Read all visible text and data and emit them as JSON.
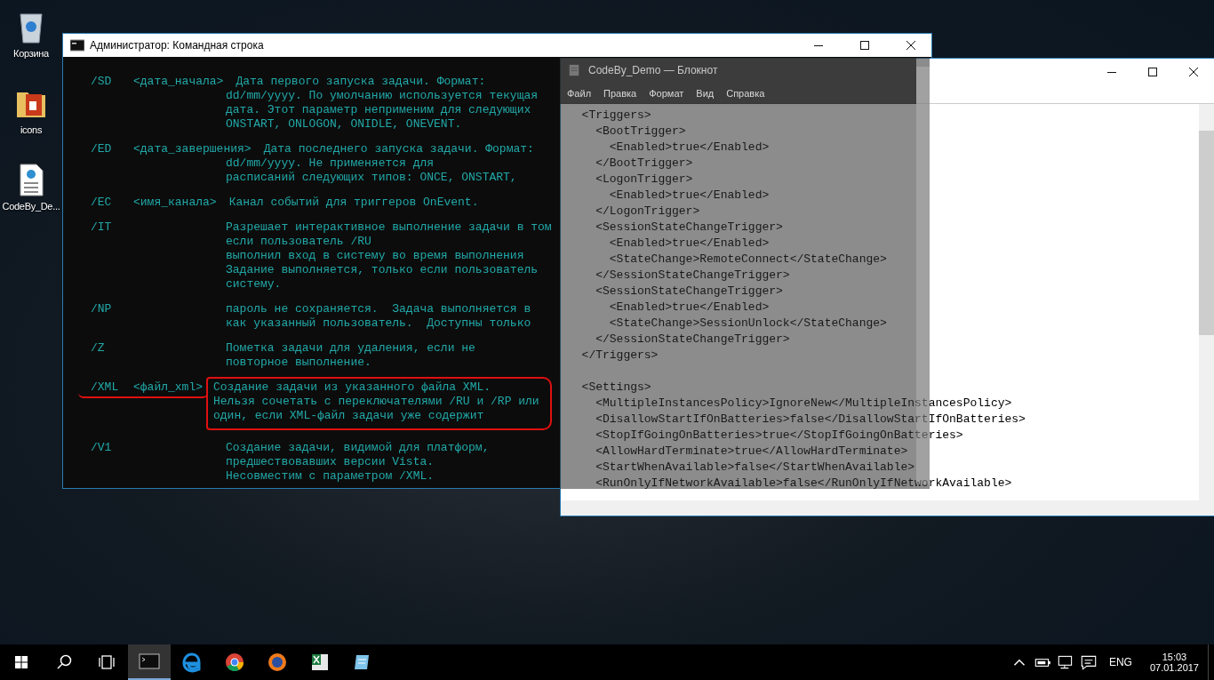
{
  "desktop_icons": [
    {
      "label": "Корзина",
      "kind": "recycle-bin"
    },
    {
      "label": "icons",
      "kind": "folder"
    },
    {
      "label": "CodeBy_De...",
      "kind": "web-file"
    }
  ],
  "cmd_window": {
    "title": "Администратор: Командная строка",
    "entries": [
      {
        "switch": "/SD",
        "arg": "<дата_начала>",
        "kind": "inline",
        "marked": false,
        "lines": [
          "Дата первого запуска задачи. Формат:",
          "dd/mm/yyyy. По умолчанию используется текущая",
          "дата. Этот параметр неприменим для следующих",
          "ONSTART, ONLOGON, ONIDLE, ONEVENT."
        ]
      },
      {
        "switch": "/ED",
        "arg": "<дата_завершения>",
        "kind": "inline",
        "marked": false,
        "lines": [
          "Дата последнего запуска задачи. Формат:",
          "dd/mm/yyyy. Не применяется для",
          "расписаний следующих типов: ONCE, ONSTART,"
        ]
      },
      {
        "switch": "/EC",
        "arg": "<имя_канала>",
        "kind": "inline",
        "marked": false,
        "lines": [
          "Канал событий для триггеров OnEvent."
        ]
      },
      {
        "switch": "/IT",
        "kind": "column",
        "marked": false,
        "lines": [
          "Разрешает интерактивное выполнение задачи в том",
          "если пользователь /RU",
          "выполнил вход в систему во время выполнения",
          "Задание выполняется, только если пользователь",
          "систему."
        ]
      },
      {
        "switch": "/NP",
        "kind": "column",
        "marked": false,
        "lines": [
          "пароль не сохраняется.  Задача выполняется в",
          "как указанный пользователь.  Доступны только"
        ]
      },
      {
        "switch": "/Z",
        "kind": "column",
        "marked": false,
        "lines": [
          "Пометка задачи для удаления, если не",
          "повторное выполнение."
        ]
      },
      {
        "switch": "/XML",
        "arg": "<файл_xml>",
        "kind": "column",
        "marked": true,
        "lines": [
          "Создание задачи из указанного файла XML.",
          "Нельзя сочетать с переключателями /RU и /RP или",
          "один, если XML-файл задачи уже содержит"
        ]
      },
      {
        "switch": "/V1",
        "kind": "column",
        "marked": false,
        "lines": [
          "Создание задачи, видимой для платформ,",
          "предшествовавших версии Vista.",
          "Несовместим с параметром /XML."
        ]
      }
    ]
  },
  "notepad": {
    "title": "CodeBy_Demo — Блокнот",
    "menu": [
      "Файл",
      "Правка",
      "Формат",
      "Вид",
      "Справка"
    ],
    "sections": [
      {
        "lines": [
          "  <Triggers>",
          "    <BootTrigger>",
          "      <Enabled>true</Enabled>",
          "    </BootTrigger>",
          "    <LogonTrigger>",
          "      <Enabled>true</Enabled>",
          "    </LogonTrigger>",
          "    <SessionStateChangeTrigger>",
          "      <Enabled>true</Enabled>",
          "      <StateChange>RemoteConnect</StateChange>",
          "    </SessionStateChangeTrigger>",
          "    <SessionStateChangeTrigger>",
          "      <Enabled>true</Enabled>",
          "      <StateChange>SessionUnlock</StateChange>",
          "    </SessionStateChangeTrigger>",
          "  </Triggers>"
        ]
      },
      {
        "lines": [
          "  <Settings>",
          "    <MultipleInstancesPolicy>IgnoreNew</MultipleInstancesPolicy>",
          "    <DisallowStartIfOnBatteries>false</DisallowStartIfOnBatteries>",
          "    <StopIfGoingOnBatteries>true</StopIfGoingOnBatteries>",
          "    <AllowHardTerminate>true</AllowHardTerminate>",
          "    <StartWhenAvailable>false</StartWhenAvailable>",
          "    <RunOnlyIfNetworkAvailable>false</RunOnlyIfNetworkAvailable>"
        ]
      }
    ]
  },
  "taskbar": {
    "apps": [
      {
        "kind": "cmd",
        "selected": true
      },
      {
        "kind": "edge",
        "selected": false
      },
      {
        "kind": "chrome",
        "selected": false
      },
      {
        "kind": "firefox",
        "selected": false
      },
      {
        "kind": "spreadsheet",
        "selected": false
      },
      {
        "kind": "notepad",
        "selected": false
      }
    ],
    "language": "ENG",
    "time": "15:03",
    "date": "07.01.2017"
  }
}
